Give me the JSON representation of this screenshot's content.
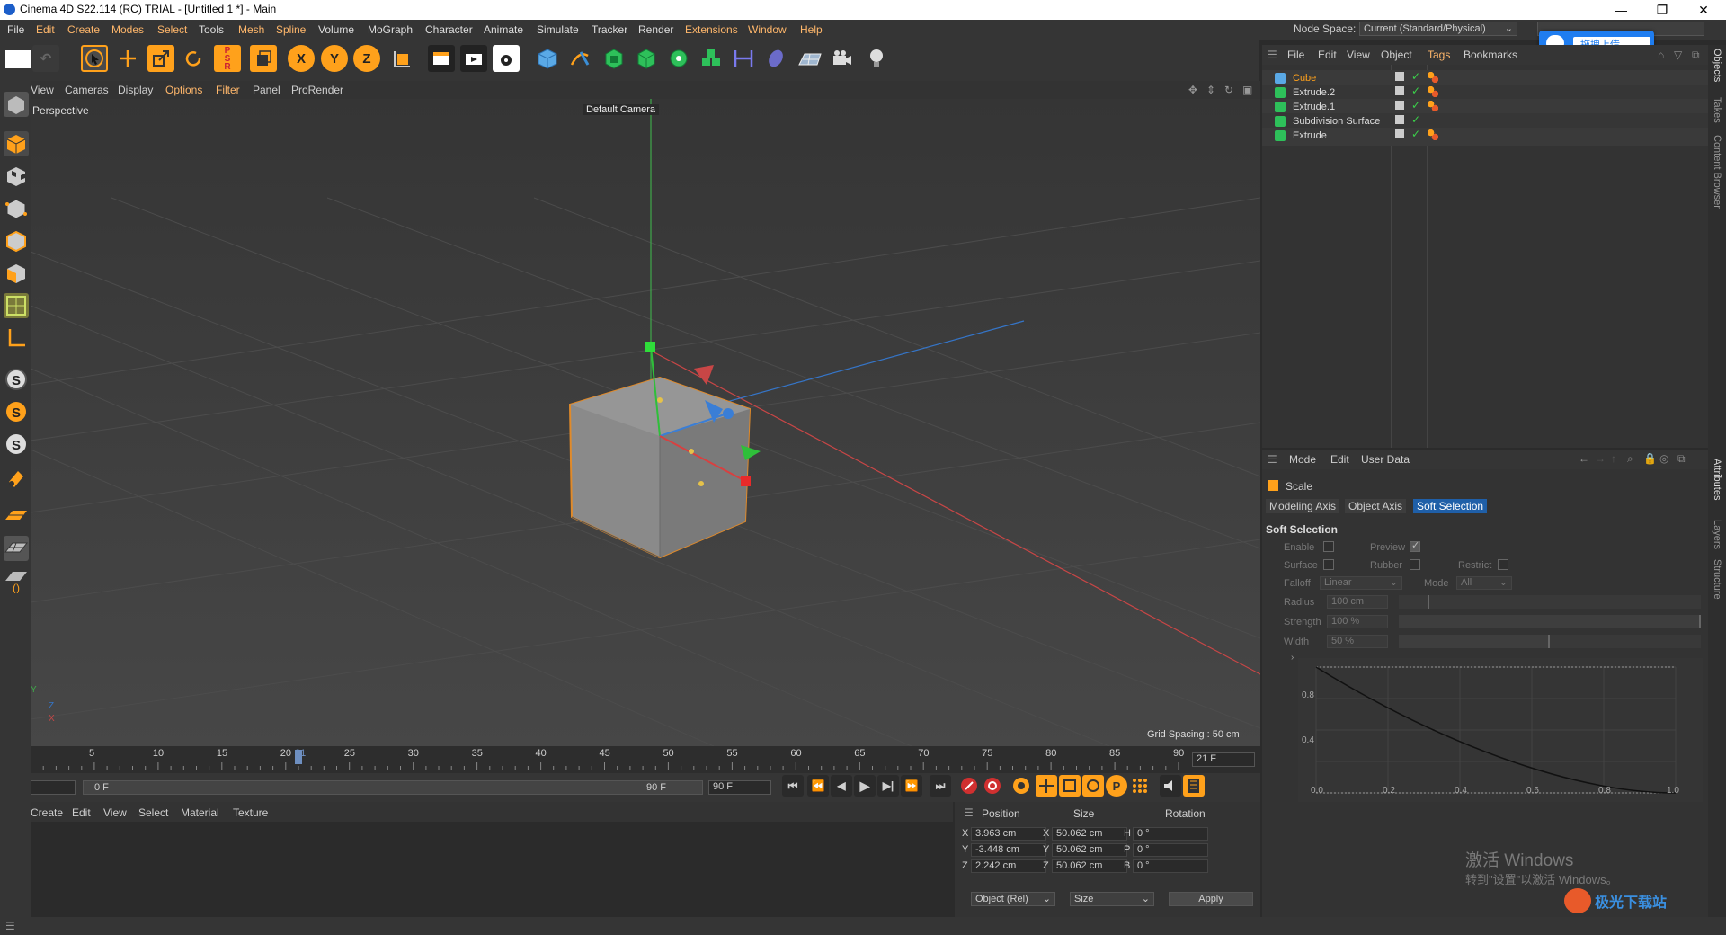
{
  "window": {
    "title": "Cinema 4D S22.114 (RC) TRIAL - [Untitled 1 *] - Main",
    "minimize": "—",
    "restore": "❐",
    "close": "✕"
  },
  "menubar": {
    "items": [
      "File",
      "Edit",
      "Create",
      "Modes",
      "Select",
      "Tools",
      "Mesh",
      "Spline",
      "Volume",
      "MoGraph",
      "Character",
      "Animate",
      "Simulate",
      "Tracker",
      "Render",
      "Extensions",
      "Window",
      "Help"
    ],
    "node_space_label": "Node Space:",
    "node_space_value": "Current (Standard/Physical)"
  },
  "upload_widget": {
    "label": "拖拽上传"
  },
  "toolbar": {
    "axis_x": "X",
    "axis_y": "Y",
    "axis_z": "Z"
  },
  "viewport": {
    "menu": [
      "View",
      "Cameras",
      "Display",
      "Options",
      "Filter",
      "Panel",
      "ProRender"
    ],
    "view_name": "Perspective",
    "camera_label": "Default Camera",
    "grid_spacing": "Grid Spacing : 50 cm",
    "axis_y": "Y",
    "axis_z": "Z",
    "axis_x": "X"
  },
  "timeline": {
    "ticks": [
      "5",
      "10",
      "15",
      "20",
      "25",
      "30",
      "35",
      "40",
      "45",
      "50",
      "55",
      "60",
      "65",
      "70",
      "75",
      "80",
      "85",
      "90"
    ],
    "current_marker": "21",
    "current_frame_field": "21 F",
    "start_frame": "0 F",
    "end_frame": "90 F",
    "end_field": "90 F"
  },
  "material": {
    "menu": [
      "Create",
      "Edit",
      "View",
      "Select",
      "Material",
      "Texture"
    ]
  },
  "coords": {
    "headers": [
      "Position",
      "Size",
      "Rotation"
    ],
    "rows": [
      {
        "axis": "X",
        "pos": "3.963 cm",
        "saxis": "X",
        "size": "50.062 cm",
        "raxis": "H",
        "rot": "0 °"
      },
      {
        "axis": "Y",
        "pos": "-3.448 cm",
        "saxis": "Y",
        "size": "50.062 cm",
        "raxis": "P",
        "rot": "0 °"
      },
      {
        "axis": "Z",
        "pos": "2.242 cm",
        "saxis": "Z",
        "size": "50.062 cm",
        "raxis": "B",
        "rot": "0 °"
      }
    ],
    "mode_select": "Object (Rel)",
    "size_select": "Size",
    "apply": "Apply"
  },
  "objects": {
    "menu": [
      "File",
      "Edit",
      "View",
      "Object",
      "Tags",
      "Bookmarks"
    ],
    "items": [
      {
        "name": "Cube",
        "selected": true
      },
      {
        "name": "Extrude.2",
        "selected": false
      },
      {
        "name": "Extrude.1",
        "selected": false
      },
      {
        "name": "Subdivision Surface",
        "selected": false
      },
      {
        "name": "Extrude",
        "selected": false
      }
    ]
  },
  "attributes": {
    "menu": [
      "Mode",
      "Edit",
      "User Data"
    ],
    "tool_name": "Scale",
    "tabs": [
      "Modeling Axis",
      "Object Axis",
      "Soft Selection"
    ],
    "active_tab": "Soft Selection",
    "section": "Soft Selection",
    "enable": "Enable",
    "preview": "Preview",
    "surface": "Surface",
    "rubber": "Rubber",
    "restrict": "Restrict",
    "falloff_label": "Falloff",
    "falloff_value": "Linear",
    "mode_label": "Mode",
    "mode_value": "All",
    "radius_label": "Radius",
    "radius_value": "100 cm",
    "radius_fill": 0.1,
    "strength_label": "Strength",
    "strength_value": "100 %",
    "strength_fill": 1.0,
    "width_label": "Width",
    "width_value": "50 %",
    "width_fill": 0.5,
    "curve_y_ticks": [
      "0.8",
      "0.4"
    ],
    "curve_x_ticks": [
      "0.0",
      "0.2",
      "0.4",
      "0.6",
      "0.8",
      "1.0"
    ]
  },
  "right_tabs": [
    "Objects",
    "Takes",
    "Content Browser",
    "Attributes",
    "Layers",
    "Structure"
  ],
  "watermark": {
    "line1": "激活 Windows",
    "line2": "转到\"设置\"以激活 Windows。"
  },
  "corner_logo": {
    "text": "极光下载站"
  }
}
